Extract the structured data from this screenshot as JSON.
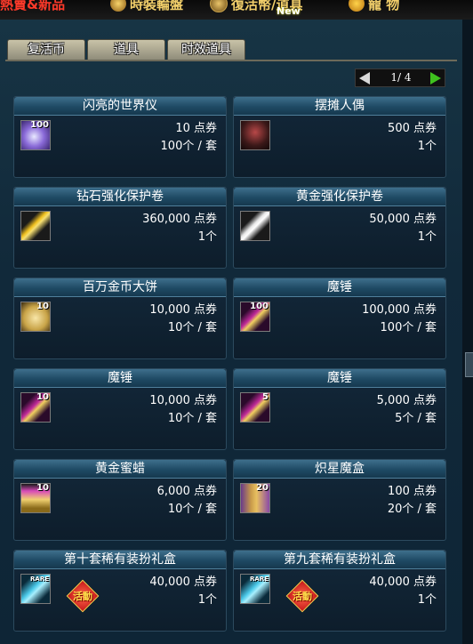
{
  "top_nav": {
    "item1": "熱賣&新品",
    "item2": "時裝輪盤",
    "item3": "復活幣/道具",
    "item3_badge": "New",
    "item4": "寵  物"
  },
  "tabs": [
    {
      "label": "复活币"
    },
    {
      "label": "道具"
    },
    {
      "label": "时效道具"
    }
  ],
  "pager": {
    "text": "1/ 4"
  },
  "items": [
    {
      "name": "闪亮的世界仪",
      "price": "10 点券",
      "qty": "100个 / 套",
      "badge": "100",
      "icon": "globe-icon"
    },
    {
      "name": "摆摊人偶",
      "price": "500 点券",
      "qty": "1个",
      "badge": "",
      "icon": "doll-icon"
    },
    {
      "name": "钻石强化保护卷",
      "price": "360,000 点券",
      "qty": "1个",
      "badge": "",
      "icon": "arrow-scroll-icon"
    },
    {
      "name": "黄金强化保护卷",
      "price": "50,000 点券",
      "qty": "1个",
      "badge": "",
      "icon": "arrow-scroll-icon"
    },
    {
      "name": "百万金币大饼",
      "price": "10,000 点券",
      "qty": "10个 / 套",
      "badge": "10",
      "icon": "coin-icon"
    },
    {
      "name": "魔锤",
      "price": "100,000 点券",
      "qty": "100个 / 套",
      "badge": "100",
      "icon": "hammer-icon"
    },
    {
      "name": "魔锤",
      "price": "10,000 点券",
      "qty": "10个 / 套",
      "badge": "10",
      "icon": "hammer-icon"
    },
    {
      "name": "魔锤",
      "price": "5,000 点券",
      "qty": "5个 / 套",
      "badge": "5",
      "icon": "hammer-icon"
    },
    {
      "name": "黄金蜜蜡",
      "price": "6,000 点券",
      "qty": "10个 / 套",
      "badge": "10",
      "icon": "wax-icon"
    },
    {
      "name": "炽星魔盒",
      "price": "100 点券",
      "qty": "20个 / 套",
      "badge": "20",
      "icon": "box-icon"
    },
    {
      "name": "第十套稀有装扮礼盒",
      "price": "40,000 点券",
      "qty": "1个",
      "badge": "RARE",
      "icon": "rare-box-icon",
      "event": "活動"
    },
    {
      "name": "第九套稀有装扮礼盒",
      "price": "40,000 点券",
      "qty": "1个",
      "badge": "RARE",
      "icon": "rare-box-icon",
      "event": "活動"
    }
  ]
}
